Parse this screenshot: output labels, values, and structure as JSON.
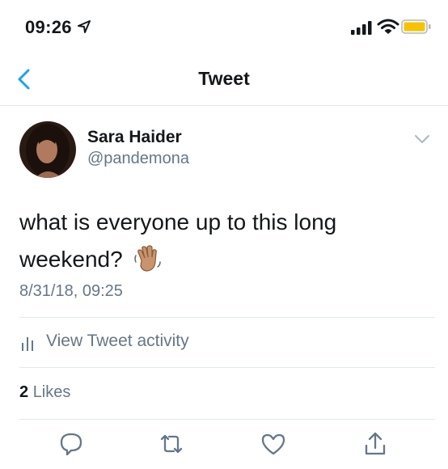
{
  "status_bar": {
    "time": "09:26",
    "icons": [
      "location-arrow-icon",
      "signal-icon",
      "wifi-icon",
      "battery-icon"
    ],
    "battery_color": "#f5c300"
  },
  "nav": {
    "title": "Tweet",
    "back_icon": "chevron-left-icon",
    "accent_color": "#1da1f2"
  },
  "tweet": {
    "author": {
      "display_name": "Sara Haider",
      "handle": "@pandemona"
    },
    "text": "what is everyone up to this long weekend?",
    "emoji": "waving-hand-icon",
    "timestamp": "8/31/18, 09:25",
    "activity_label": "View Tweet activity",
    "likes": {
      "count": "2",
      "label": "Likes"
    },
    "actions": [
      "reply-icon",
      "retweet-icon",
      "like-icon",
      "share-icon"
    ]
  }
}
